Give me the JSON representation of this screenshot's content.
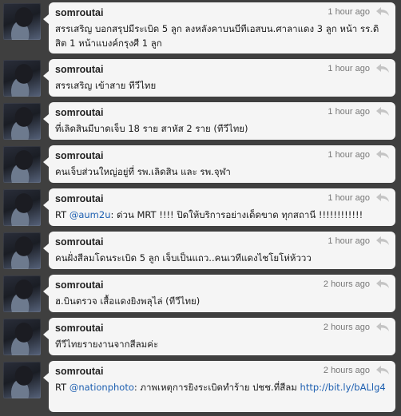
{
  "reply_icon": "reply-arrow-icon",
  "colors": {
    "background": "#3c3c3c",
    "bubble": "#f5f5f5",
    "link": "#1d5fb0"
  },
  "tweets": [
    {
      "user": "somroutai",
      "time": "1 hour ago",
      "pre": "สรรเสริญ บอกสรุปมีระเบิด 5 ลูก ลงหลังคาบนบีทีเอสบน.ศาลาแดง 3 ลูก หน้า รร.ดิสิต 1 หน้าแบงค์กรุงศี 1 ลูก",
      "link": "",
      "post": ""
    },
    {
      "user": "somroutai",
      "time": "1 hour ago",
      "pre": "สรรเสริญ เข้าสาย ทีวีไทย",
      "link": "",
      "post": ""
    },
    {
      "user": "somroutai",
      "time": "1 hour ago",
      "pre": "ที่เลิดสินมีบาดเจ็บ 18 ราย สาหัส 2 ราย (ทีวีไทย)",
      "link": "",
      "post": ""
    },
    {
      "user": "somroutai",
      "time": "1 hour ago",
      "pre": "คนเจ็บส่วนใหญ่อยู่ที่ รพ.เลิดสิน และ รพ.จุฬา",
      "link": "",
      "post": ""
    },
    {
      "user": "somroutai",
      "time": "1 hour ago",
      "pre": "RT ",
      "link": "@aum2u",
      "post": ": ด่วน MRT !!!! ปิดให้บริการอย่างเด็ดขาด ทุกสถานี !!!!!!!!!!!!"
    },
    {
      "user": "somroutai",
      "time": "1 hour ago",
      "pre": "คนฝั่งสีลมโดนระเบิด 5 ลูก เจ็บเป็นแถว..คนเวทีแดงไชโยโห่ห้ววว",
      "link": "",
      "post": ""
    },
    {
      "user": "somroutai",
      "time": "2 hours ago",
      "pre": "ฮ.บินตรวจ เสื้อแดงยิงพลุไล่ (ทีวีไทย)",
      "link": "",
      "post": ""
    },
    {
      "user": "somroutai",
      "time": "2 hours ago",
      "pre": "ทีวีไทยรายงานจากสีลมค่ะ",
      "link": "",
      "post": ""
    },
    {
      "user": "somroutai",
      "time": "2 hours ago",
      "pre": "RT ",
      "link": "@nationphoto",
      "post": ": ภาพเหตุการยิงระเบิดทำร้าย ปชช.ที่สีลม ",
      "link2": "http://bit.ly/bALlg4"
    }
  ]
}
